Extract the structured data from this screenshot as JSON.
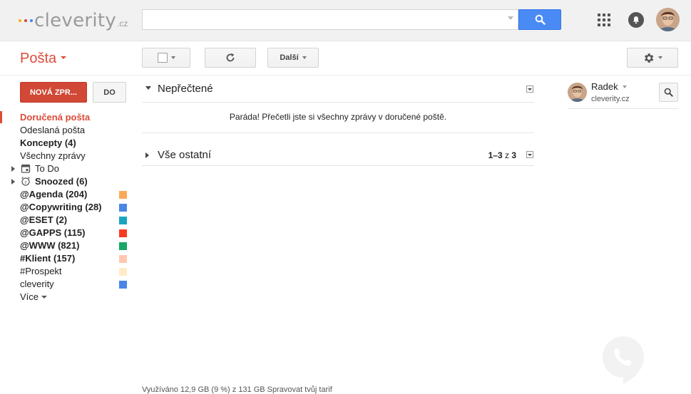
{
  "header": {
    "logo": {
      "brand": "cleverity",
      "tld": ".cz",
      "dot_colors": [
        "#f4b400",
        "#db4437",
        "#4285f4"
      ]
    },
    "search": {
      "value": "",
      "placeholder": ""
    },
    "icons": {
      "search": "search-icon",
      "apps": "apps-grid-icon",
      "notifications": "bell-icon",
      "account": "avatar"
    }
  },
  "toolbar": {
    "mail_title": "Pošta",
    "more_label": "Další",
    "icons": {
      "select": "checkbox-icon",
      "refresh": "refresh-icon",
      "settings": "gear-icon"
    }
  },
  "sidebar": {
    "compose_label": "NOVÁ ZPR...",
    "do_label": "DO",
    "items": [
      {
        "label": "Doručená pošta",
        "active": true
      },
      {
        "label": "Odeslaná pošta"
      },
      {
        "label": "Koncepty (4)",
        "bold": true
      },
      {
        "label": "Všechny zprávy"
      },
      {
        "label": "To Do",
        "icon": "calendar-icon",
        "expandable": true
      },
      {
        "label": "Snoozed (6)",
        "icon": "alarm-clock-icon",
        "expandable": true,
        "bold": true
      },
      {
        "label": "@Agenda (204)",
        "bold": true,
        "color": "#fda859"
      },
      {
        "label": "@Copywriting (28)",
        "bold": true,
        "color": "#4986e7"
      },
      {
        "label": "@ESET (2)",
        "bold": true,
        "color": "#19a5c2"
      },
      {
        "label": "@GAPPS (115)",
        "bold": true,
        "color": "#f83a22"
      },
      {
        "label": "@WWW (821)",
        "bold": true,
        "color": "#16a765"
      },
      {
        "label": "#Klient (157)",
        "bold": true,
        "color": "#ffc8af"
      },
      {
        "label": "#Prospekt",
        "color": "#ffebc6"
      },
      {
        "label": "cleverity",
        "color": "#4986e7"
      }
    ],
    "more_label": "Více"
  },
  "main": {
    "unread": {
      "title": "Nepřečtené",
      "message": "Paráda! Přečetli jste si všechny zprávy v doručené poště."
    },
    "everything": {
      "title": "Vše ostatní",
      "range": "1–3",
      "of": "z",
      "total": "3"
    },
    "footer": "Využíváno 12,9 GB (9 %) z 131 GB       Spravovat tvůj tarif"
  },
  "contact": {
    "name": "Radek",
    "domain": "cleverity.cz"
  },
  "colors": {
    "accent_red": "#dd4b39",
    "search_blue": "#4a8af4"
  }
}
